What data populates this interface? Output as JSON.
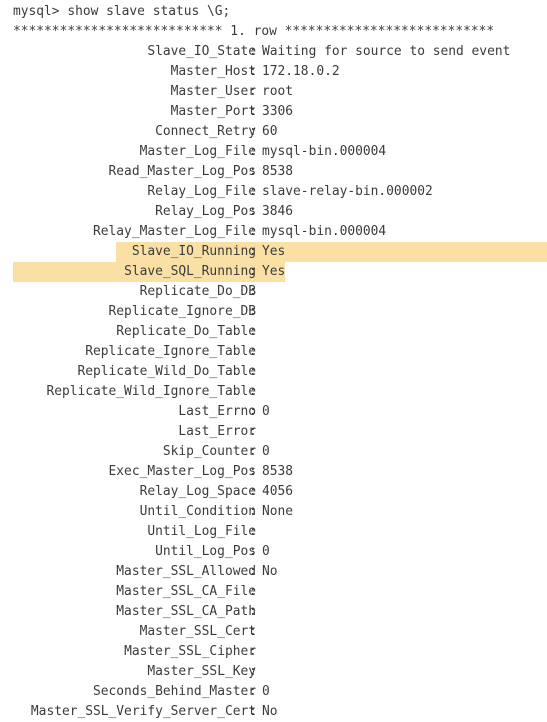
{
  "terminal": {
    "prompt_line": "mysql> show slave status \\G;",
    "row_header": "*************************** 1. row ***************************",
    "highlight_color": "#fbe0a6",
    "fields": [
      {
        "name": "Slave_IO_State",
        "value": "Waiting for source to send event",
        "highlighted": false
      },
      {
        "name": "Master_Host",
        "value": "172.18.0.2",
        "highlighted": false
      },
      {
        "name": "Master_User",
        "value": "root",
        "highlighted": false
      },
      {
        "name": "Master_Port",
        "value": "3306",
        "highlighted": false
      },
      {
        "name": "Connect_Retry",
        "value": "60",
        "highlighted": false
      },
      {
        "name": "Master_Log_File",
        "value": "mysql-bin.000004",
        "highlighted": false
      },
      {
        "name": "Read_Master_Log_Pos",
        "value": "8538",
        "highlighted": false
      },
      {
        "name": "Relay_Log_File",
        "value": "slave-relay-bin.000002",
        "highlighted": false
      },
      {
        "name": "Relay_Log_Pos",
        "value": "3846",
        "highlighted": false
      },
      {
        "name": "Relay_Master_Log_File",
        "value": "mysql-bin.000004",
        "highlighted": false
      },
      {
        "name": "Slave_IO_Running",
        "value": "Yes",
        "highlighted": true
      },
      {
        "name": "Slave_SQL_Running",
        "value": "Yes",
        "highlighted": true
      },
      {
        "name": "Replicate_Do_DB",
        "value": "",
        "highlighted": false
      },
      {
        "name": "Replicate_Ignore_DB",
        "value": "",
        "highlighted": false
      },
      {
        "name": "Replicate_Do_Table",
        "value": "",
        "highlighted": false
      },
      {
        "name": "Replicate_Ignore_Table",
        "value": "",
        "highlighted": false
      },
      {
        "name": "Replicate_Wild_Do_Table",
        "value": "",
        "highlighted": false
      },
      {
        "name": "Replicate_Wild_Ignore_Table",
        "value": "",
        "highlighted": false
      },
      {
        "name": "Last_Errno",
        "value": "0",
        "highlighted": false
      },
      {
        "name": "Last_Error",
        "value": "",
        "highlighted": false
      },
      {
        "name": "Skip_Counter",
        "value": "0",
        "highlighted": false
      },
      {
        "name": "Exec_Master_Log_Pos",
        "value": "8538",
        "highlighted": false
      },
      {
        "name": "Relay_Log_Space",
        "value": "4056",
        "highlighted": false
      },
      {
        "name": "Until_Condition",
        "value": "None",
        "highlighted": false
      },
      {
        "name": "Until_Log_File",
        "value": "",
        "highlighted": false
      },
      {
        "name": "Until_Log_Pos",
        "value": "0",
        "highlighted": false
      },
      {
        "name": "Master_SSL_Allowed",
        "value": "No",
        "highlighted": false
      },
      {
        "name": "Master_SSL_CA_File",
        "value": "",
        "highlighted": false
      },
      {
        "name": "Master_SSL_CA_Path",
        "value": "",
        "highlighted": false
      },
      {
        "name": "Master_SSL_Cert",
        "value": "",
        "highlighted": false
      },
      {
        "name": "Master_SSL_Cipher",
        "value": "",
        "highlighted": false
      },
      {
        "name": "Master_SSL_Key",
        "value": "",
        "highlighted": false
      },
      {
        "name": "Seconds_Behind_Master",
        "value": "0",
        "highlighted": false
      },
      {
        "name": "Master_SSL_Verify_Server_Cert",
        "value": "No",
        "highlighted": false
      }
    ]
  }
}
